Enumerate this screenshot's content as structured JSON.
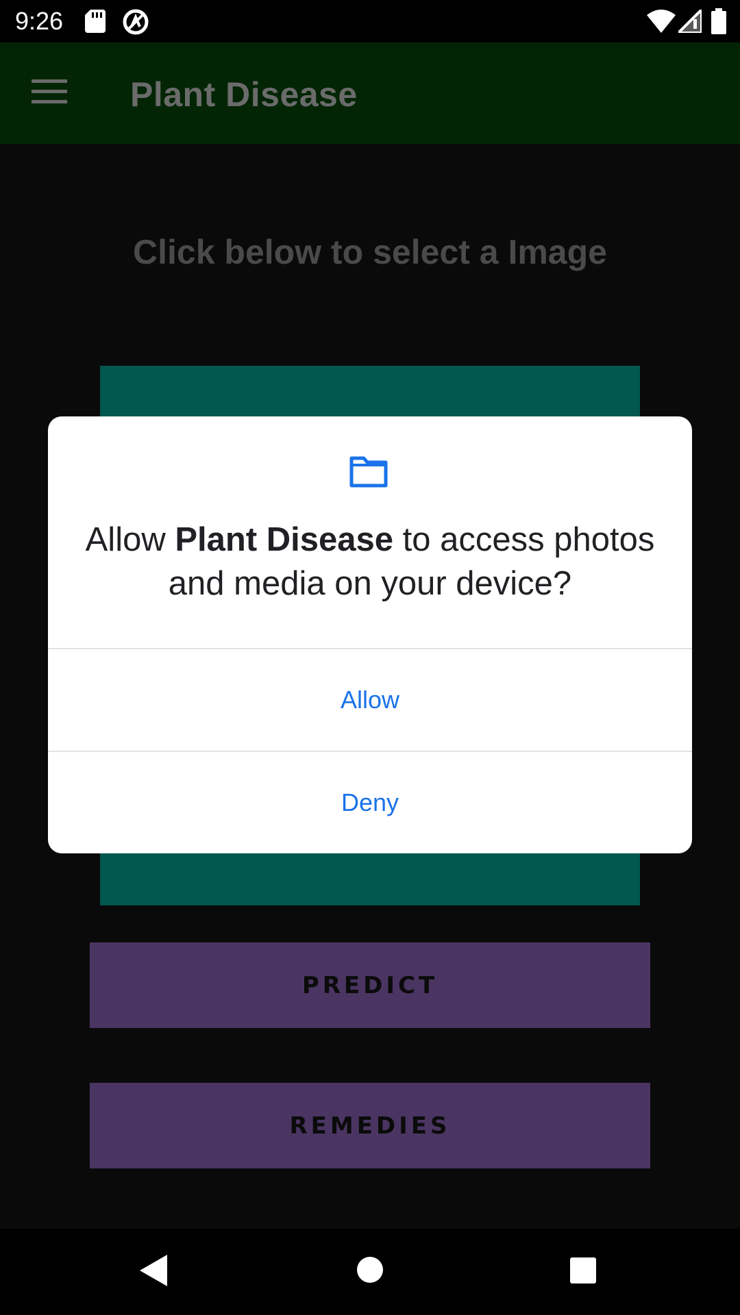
{
  "status_bar": {
    "time": "9:26"
  },
  "app_bar": {
    "title": "Plant Disease"
  },
  "content": {
    "instruction": "Click below to select a Image",
    "predict_label": "PREDICT",
    "remedies_label": "REMEDIES"
  },
  "dialog": {
    "message_prefix": "Allow ",
    "app_name": "Plant Disease",
    "message_suffix": " to access photos and media on your device?",
    "allow_label": "Allow",
    "deny_label": "Deny",
    "icon": "folder-icon"
  },
  "colors": {
    "app_bar": "#032505",
    "image_area": "#02574e",
    "button": "#4a3562",
    "dialog_accent": "#1a73e8"
  }
}
